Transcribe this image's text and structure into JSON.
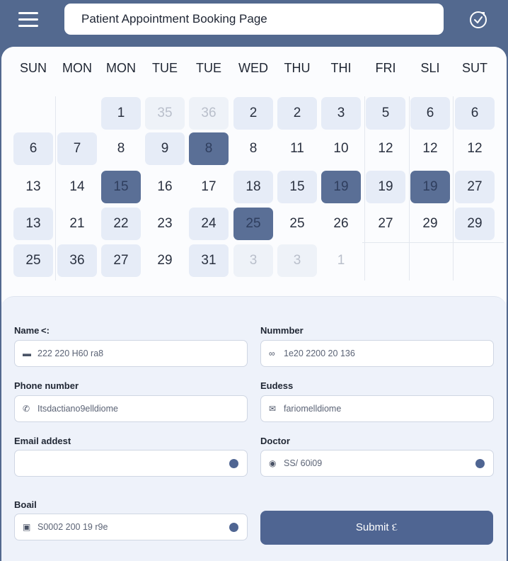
{
  "header": {
    "title": "Patient Appointment Booking Page"
  },
  "calendar": {
    "weekdays": [
      "SUN",
      "MON",
      "MON",
      "TUE",
      "TUE",
      "WED",
      "THU",
      "THI",
      "FRI",
      "SLI",
      "SUT"
    ],
    "rows": [
      [
        {
          "t": "",
          "s": "empty"
        },
        {
          "t": "",
          "s": "empty"
        },
        {
          "t": "1",
          "s": "light"
        },
        {
          "t": "35",
          "s": "muted-light"
        },
        {
          "t": "36",
          "s": "muted-light"
        },
        {
          "t": "2",
          "s": "light"
        },
        {
          "t": "2",
          "s": "light"
        },
        {
          "t": "3",
          "s": "light"
        },
        {
          "t": "5",
          "s": "light"
        },
        {
          "t": "6",
          "s": "light"
        },
        {
          "t": "6",
          "s": "light"
        }
      ],
      [
        {
          "t": "6",
          "s": "light"
        },
        {
          "t": "7",
          "s": "light"
        },
        {
          "t": "8",
          "s": "plain"
        },
        {
          "t": "9",
          "s": "light"
        },
        {
          "t": "8",
          "s": "dark"
        },
        {
          "t": "8",
          "s": "plain"
        },
        {
          "t": "11",
          "s": "plain"
        },
        {
          "t": "10",
          "s": "plain"
        },
        {
          "t": "12",
          "s": "plain"
        },
        {
          "t": "12",
          "s": "plain"
        },
        {
          "t": "12",
          "s": "plain"
        }
      ],
      [
        {
          "t": "13",
          "s": "plain"
        },
        {
          "t": "14",
          "s": "plain"
        },
        {
          "t": "15",
          "s": "dark"
        },
        {
          "t": "16",
          "s": "plain"
        },
        {
          "t": "17",
          "s": "plain"
        },
        {
          "t": "18",
          "s": "light"
        },
        {
          "t": "15",
          "s": "light"
        },
        {
          "t": "19",
          "s": "dark"
        },
        {
          "t": "19",
          "s": "light"
        },
        {
          "t": "19",
          "s": "dark"
        },
        {
          "t": "27",
          "s": "light"
        }
      ],
      [
        {
          "t": "13",
          "s": "light"
        },
        {
          "t": "21",
          "s": "plain"
        },
        {
          "t": "22",
          "s": "light"
        },
        {
          "t": "23",
          "s": "plain"
        },
        {
          "t": "24",
          "s": "light"
        },
        {
          "t": "25",
          "s": "dark"
        },
        {
          "t": "25",
          "s": "plain"
        },
        {
          "t": "26",
          "s": "plain"
        },
        {
          "t": "27",
          "s": "plain"
        },
        {
          "t": "29",
          "s": "plain"
        },
        {
          "t": "29",
          "s": "light"
        }
      ],
      [
        {
          "t": "25",
          "s": "light"
        },
        {
          "t": "36",
          "s": "light"
        },
        {
          "t": "27",
          "s": "light"
        },
        {
          "t": "29",
          "s": "plain"
        },
        {
          "t": "31",
          "s": "light"
        },
        {
          "t": "3",
          "s": "muted-light"
        },
        {
          "t": "3",
          "s": "muted-light"
        },
        {
          "t": "1",
          "s": "muted"
        },
        {
          "t": "",
          "s": "empty"
        },
        {
          "t": "",
          "s": "empty"
        },
        {
          "t": "",
          "s": "empty"
        }
      ]
    ]
  },
  "form": {
    "name": {
      "label": "Name ˂:",
      "value": "222 220 H60 ra8",
      "icon": "card-icon"
    },
    "number": {
      "label": "Nummber",
      "value": "1e20 2200 20 136",
      "icon": "link-icon"
    },
    "phone": {
      "label": "Phone number",
      "value": "Itsdactiano9elldiome",
      "icon": "phone-icon"
    },
    "eudess": {
      "label": "Eudess",
      "value": "fariomelldiome",
      "icon": "mail-icon"
    },
    "email": {
      "label": "Email addest",
      "value": ""
    },
    "doctor": {
      "label": "Doctor",
      "value": "SS/ 60i09",
      "icon": "doctor-icon"
    },
    "boail": {
      "label": "Boail",
      "value": "S0002 200 19 r9e",
      "icon": "calendar-icon"
    },
    "submit_label": "Submit દ"
  },
  "colors": {
    "header": "#53698f",
    "accent": "#4f6592",
    "selected_day": "#5a6f96",
    "available_day": "#e6ecf7"
  }
}
